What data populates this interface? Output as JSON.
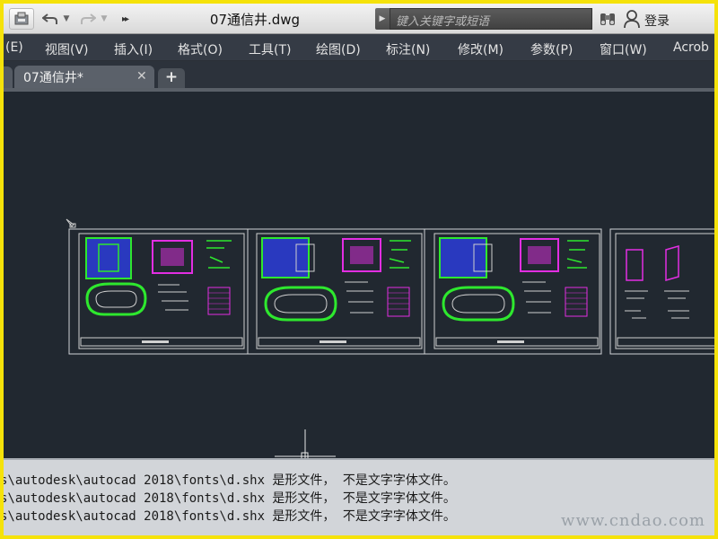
{
  "window": {
    "title": "07通信井.dwg"
  },
  "quick_access": {
    "app_icon": "autocad-app-icon",
    "undo_icon": "undo-icon",
    "redo_icon": "redo-icon",
    "more": "▸▸"
  },
  "search": {
    "placeholder": "键入关键字或短语"
  },
  "account": {
    "login_label": "登录",
    "binoculars_icon": "binoculars-icon",
    "user_icon": "user-icon"
  },
  "menu": {
    "items": [
      {
        "label": "(E)"
      },
      {
        "label": "视图(V)"
      },
      {
        "label": "插入(I)"
      },
      {
        "label": "格式(O)"
      },
      {
        "label": "工具(T)"
      },
      {
        "label": "绘图(D)"
      },
      {
        "label": "标注(N)"
      },
      {
        "label": "修改(M)"
      },
      {
        "label": "参数(P)"
      },
      {
        "label": "窗口(W)"
      },
      {
        "label": "Acrob"
      }
    ]
  },
  "tabs": [
    {
      "label": "07通信井*",
      "close": "✕"
    }
  ],
  "tab_add": "+",
  "command_history": [
    "s\\autodesk\\autocad 2018\\fonts\\d.shx 是形文件， 不是文字字体文件。",
    "s\\autodesk\\autocad 2018\\fonts\\d.shx 是形文件， 不是文字字体文件。",
    "s\\autodesk\\autocad 2018\\fonts\\d.shx 是形文件， 不是文字字体文件。"
  ],
  "watermark": "www.cndao.com",
  "colors": {
    "highlight_border": "#f5e20a",
    "canvas": "#212830",
    "menubar": "#353b45",
    "drawing_green": "#2ee82e",
    "drawing_magenta": "#e22ee2",
    "drawing_blue": "#2a3cd8",
    "drawing_white": "#d8d8d8"
  }
}
